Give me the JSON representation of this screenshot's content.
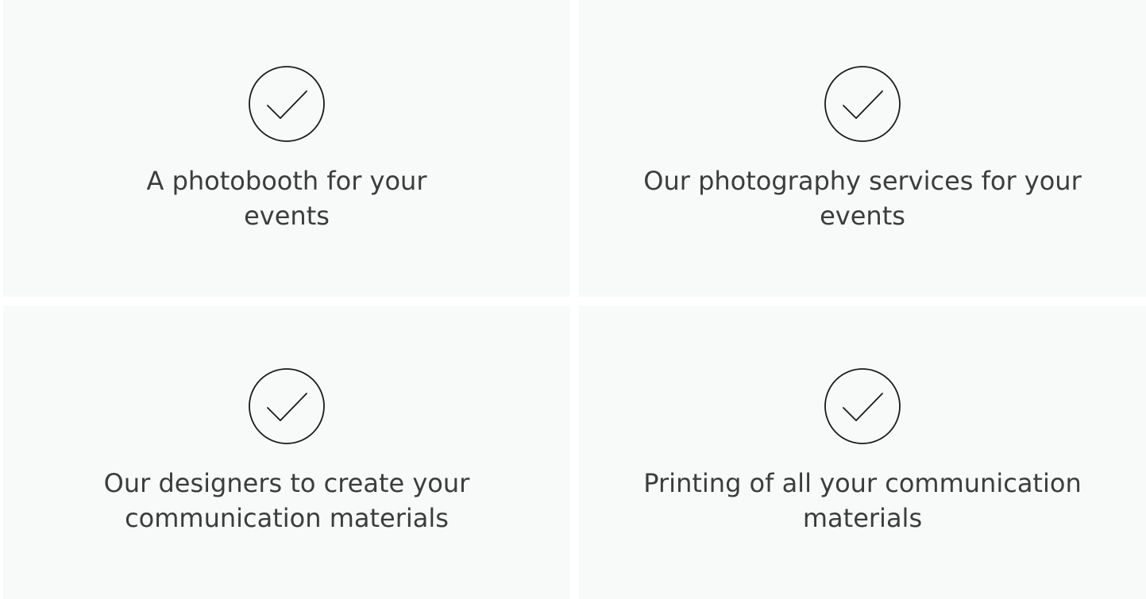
{
  "features": [
    {
      "title": "A photobooth for your events",
      "icon": "check-circle-icon"
    },
    {
      "title": "Our photography services for your events",
      "icon": "check-circle-icon"
    },
    {
      "title": "Our designers to create your communication materials",
      "icon": "check-circle-icon"
    },
    {
      "title": "Printing of all your communication materials",
      "icon": "check-circle-icon"
    }
  ],
  "colors": {
    "card_background": "#f8f9f9",
    "text": "#3c3c3c",
    "icon_stroke": "#1a1a1a"
  }
}
